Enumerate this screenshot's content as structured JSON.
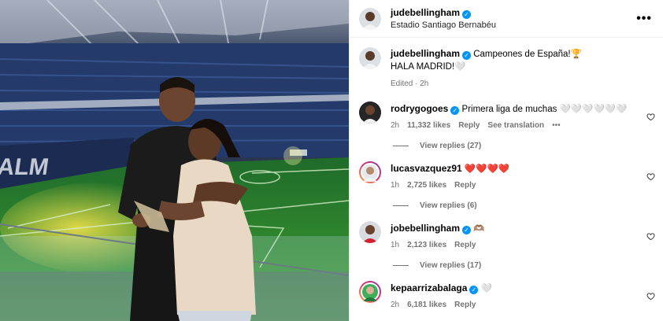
{
  "post": {
    "username": "judebellingham",
    "location": "Estadio Santiago Bernabéu",
    "caption_text": "Campeones de España!",
    "caption_emoji": "🏆",
    "caption_line2": "HALA MADRID!🤍",
    "caption_meta": "Edited · 2h",
    "more_icon": "•••"
  },
  "comments": [
    {
      "username": "rodrygogoes",
      "text": "Primera liga de muchas 🤍🤍🤍🤍🤍🤍",
      "time": "2h",
      "likes": "11,332 likes",
      "reply": "Reply",
      "translate": "See translation",
      "options": "•••",
      "view_replies": "View replies (27)"
    },
    {
      "username": "lucasvazquez91",
      "text": "❤️❤️❤️❤️",
      "time": "1h",
      "likes": "2,725 likes",
      "reply": "Reply",
      "view_replies": "View replies (6)"
    },
    {
      "username": "jobebellingham",
      "text": "🫶🏽",
      "time": "1h",
      "likes": "2,123 likes",
      "reply": "Reply",
      "view_replies": "View replies (17)"
    },
    {
      "username": "kepaarrizabalaga",
      "text": "🤍",
      "time": "2h",
      "likes": "6,181 likes",
      "reply": "Reply"
    }
  ],
  "colors": {
    "accent": "#0095f6",
    "heart_red": "#e0102a",
    "muted": "#737373"
  }
}
